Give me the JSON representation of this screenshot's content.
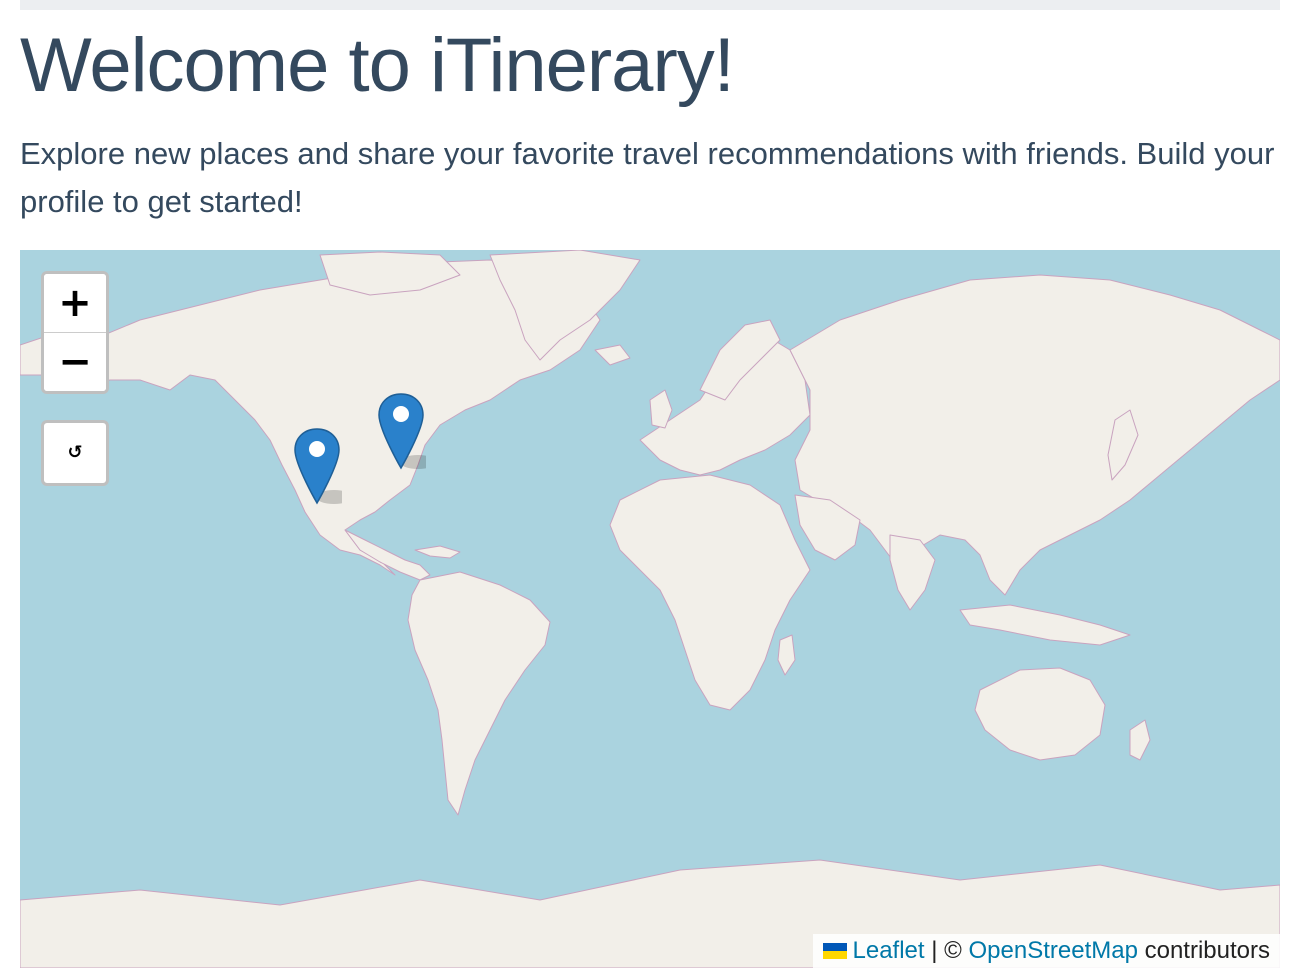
{
  "header": {
    "title": "Welcome to iTinerary!",
    "intro": "Explore new places and share your favorite travel recommendations with friends. Build your profile to get started!"
  },
  "map": {
    "zoom_in_label": "+",
    "zoom_out_label": "−",
    "reset_label": "↺",
    "markers": [
      {
        "name": "map-marker-west-coast",
        "icon": "map-pin-icon"
      },
      {
        "name": "map-marker-great-lakes",
        "icon": "map-pin-icon"
      }
    ],
    "attribution": {
      "leaflet_label": "Leaflet",
      "separator": " | © ",
      "osm_label": "OpenStreetMap",
      "suffix": " contributors"
    },
    "colors": {
      "water": "#aad3df",
      "land": "#f2efe9",
      "border": "#c9a3bf",
      "marker": "#2a81cb",
      "link": "#0078a8"
    }
  }
}
